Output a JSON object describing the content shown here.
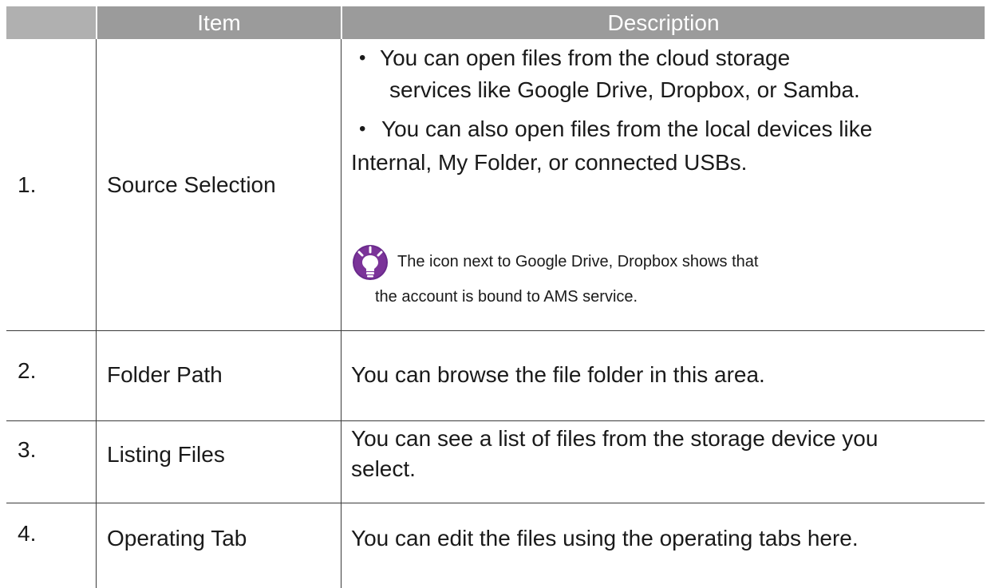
{
  "table": {
    "headers": {
      "number": "",
      "item": "Item",
      "description": "Description"
    },
    "rows": [
      {
        "number": "1.",
        "item": "Source Selection",
        "bullets": [
          {
            "line1": "You can open files from the cloud storage",
            "line2": "services like Google Drive, Dropbox, or Samba."
          },
          {
            "line1": "You can also open files from the local devices like",
            "line2": "Internal, My Folder, or connected USBs."
          }
        ],
        "note": {
          "line1": "The icon next to Google Drive, Dropbox shows that",
          "line2": "the account is bound to AMS service."
        }
      },
      {
        "number": "2.",
        "item": "Folder Path",
        "description": "You can browse the file folder in this area."
      },
      {
        "number": "3.",
        "item": "Listing Files",
        "description_line1": "You can see a list of files from the storage device you",
        "description_line2": "select."
      },
      {
        "number": "4.",
        "item": "Operating Tab",
        "description": "You can edit the files using the operating tabs here."
      }
    ]
  },
  "icons": {
    "tip": "lightbulb-tip-icon",
    "bullet": "bullet-dot"
  },
  "colors": {
    "header_bg": "#9b9b9b",
    "header_text": "#ffffff",
    "tip_icon": "#6a2a8c",
    "rule": "#3a3a3a"
  }
}
